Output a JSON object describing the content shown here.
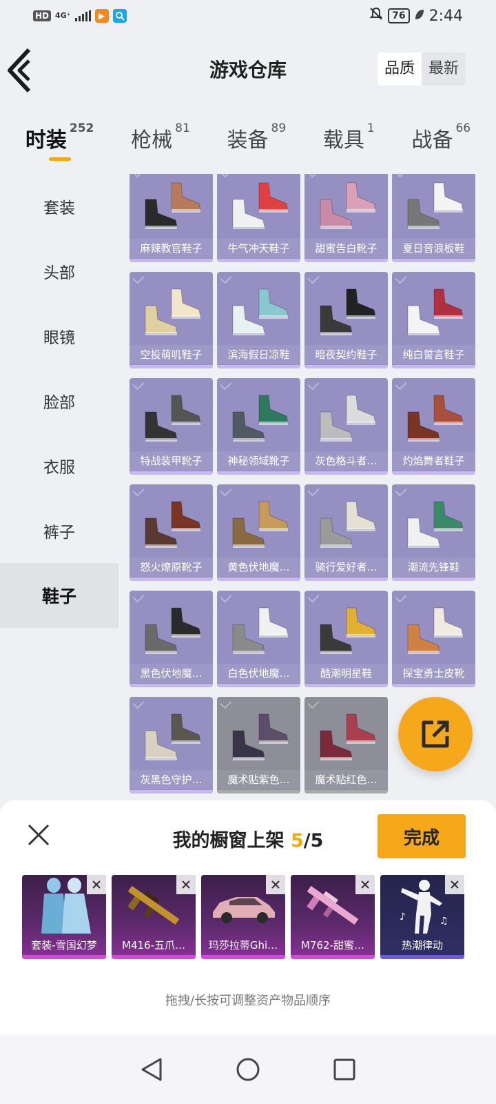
{
  "status_bar": {
    "badge": "HD",
    "network": "4G⁺",
    "battery": "76",
    "time": "2:44",
    "icons": [
      "hd-icon",
      "signal-icon",
      "video-app-icon",
      "search-app-icon",
      "mute-icon",
      "battery-icon",
      "leaf-icon"
    ]
  },
  "header": {
    "title": "游戏仓库",
    "sort_options": [
      "品质",
      "最新"
    ],
    "sort_active": "品质"
  },
  "tabs": [
    {
      "label": "时装",
      "count": "252"
    },
    {
      "label": "枪械",
      "count": "81"
    },
    {
      "label": "装备",
      "count": "89"
    },
    {
      "label": "载具",
      "count": "1"
    },
    {
      "label": "战备",
      "count": "66"
    }
  ],
  "sidebar": {
    "items": [
      "套装",
      "头部",
      "眼镜",
      "脸部",
      "衣服",
      "裤子",
      "鞋子"
    ],
    "active": "鞋子"
  },
  "grid": {
    "items": [
      {
        "name": "麻辣教官鞋子",
        "colors": [
          "#b77a5a",
          "#2a2a2a"
        ]
      },
      {
        "name": "牛气冲天鞋子",
        "colors": [
          "#e04040",
          "#f0f0f0"
        ]
      },
      {
        "name": "甜蜜告白靴子",
        "colors": [
          "#d9a0b8",
          "#c88aa4"
        ]
      },
      {
        "name": "夏日音浪板鞋",
        "colors": [
          "#f4f4f4",
          "#777777"
        ]
      },
      {
        "name": "空投萌叽鞋子",
        "colors": [
          "#f0e6c8",
          "#e0d0a0"
        ]
      },
      {
        "name": "滨海假日凉鞋",
        "colors": [
          "#8ac8d0",
          "#e8f0f0"
        ]
      },
      {
        "name": "暗夜契约鞋子",
        "colors": [
          "#222222",
          "#3a3a3a"
        ]
      },
      {
        "name": "纯白誓言鞋子",
        "colors": [
          "#b03040",
          "#f4f4f4"
        ]
      },
      {
        "name": "特战装甲靴子",
        "colors": [
          "#555555",
          "#333333"
        ]
      },
      {
        "name": "神秘领域靴子",
        "colors": [
          "#2e7a5e",
          "#505a60"
        ]
      },
      {
        "name": "灰色格斗者…",
        "colors": [
          "#dcdcdc",
          "#bcbcbc"
        ]
      },
      {
        "name": "灼焰舞者鞋子",
        "colors": [
          "#a8503c",
          "#7a3424"
        ]
      },
      {
        "name": "怒火燎原靴子",
        "colors": [
          "#7a3424",
          "#5a3a30"
        ]
      },
      {
        "name": "黄色伏地魔…",
        "colors": [
          "#c89a58",
          "#8a6a40"
        ]
      },
      {
        "name": "骑行爱好者…",
        "colors": [
          "#e4e0d4",
          "#9a9a9a"
        ]
      },
      {
        "name": "潮流先锋鞋",
        "colors": [
          "#3a8a6a",
          "#f0f0f0"
        ]
      },
      {
        "name": "黑色伏地魔…",
        "colors": [
          "#2a2a2a",
          "#6a6a6a"
        ]
      },
      {
        "name": "白色伏地魔…",
        "colors": [
          "#f0f0f0",
          "#8a8a8a"
        ]
      },
      {
        "name": "酷潮明星鞋",
        "colors": [
          "#e0b030",
          "#3a3a3a"
        ]
      },
      {
        "name": "探宝勇士皮靴",
        "colors": [
          "#f0ebe0",
          "#d08040"
        ]
      },
      {
        "name": "灰黑色守护…",
        "colors": [
          "#5a5650",
          "#d8d0c0"
        ]
      },
      {
        "name": "魔术贴紫色…",
        "colors": [
          "#5a4e68",
          "#3a3448"
        ]
      },
      {
        "name": "魔术贴红色…",
        "colors": [
          "#a84050",
          "#7a2a38"
        ]
      }
    ]
  },
  "showcase": {
    "title_prefix": "我的橱窗上架 ",
    "count": "5",
    "total": "/5",
    "done_label": "完成",
    "items": [
      {
        "name": "套装-雪国幻梦"
      },
      {
        "name": "M416-五爪…"
      },
      {
        "name": "玛莎拉蒂Ghi…"
      },
      {
        "name": "M762-甜蜜…"
      },
      {
        "name": "热潮律动"
      }
    ],
    "hint": "拖拽/长按可调整资产物品顺序"
  }
}
